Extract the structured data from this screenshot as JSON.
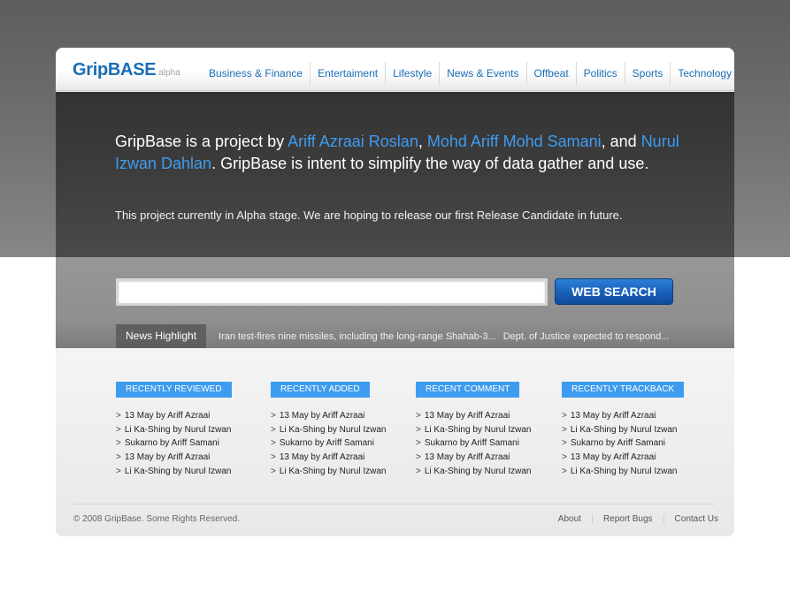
{
  "header": {
    "logo": "GripBASE",
    "logo_tag": "alpha",
    "nav": [
      "Business & Finance",
      "Entertaiment",
      "Lifestyle",
      "News & Events",
      "Offbeat",
      "Politics",
      "Sports",
      "Technology"
    ]
  },
  "hero": {
    "intro_prefix": "GripBase is a project by ",
    "author1": "Ariff Azraai Roslan",
    "sep1": ", ",
    "author2": "Mohd Ariff Mohd Samani",
    "sep2": ", and ",
    "author3": "Nurul Izwan Dahlan",
    "intro_suffix": ". GripBase is intent to simplify the way of data gather and use.",
    "subtext": "This project currently in Alpha stage. We are hoping to release our first Release Candidate in future."
  },
  "search": {
    "value": "",
    "button_label": "WEB SEARCH"
  },
  "news": {
    "label": "News Highlight",
    "items": [
      "Iran test-fires nine missiles, including the long-range Shahab-3...",
      "Dept. of Justice expected to respond..."
    ]
  },
  "lists": [
    {
      "heading": "RECENTLY REVIEWED",
      "items": [
        "13 May by Ariff Azraai",
        "Li Ka-Shing by Nurul Izwan",
        "Sukarno by Ariff Samani",
        "13 May by Ariff Azraai",
        "Li Ka-Shing by Nurul Izwan"
      ]
    },
    {
      "heading": "RECENTLY ADDED",
      "items": [
        "13 May by Ariff Azraai",
        "Li Ka-Shing by Nurul Izwan",
        "Sukarno by Ariff Samani",
        "13 May by Ariff Azraai",
        "Li Ka-Shing by Nurul Izwan"
      ]
    },
    {
      "heading": "RECENT COMMENT",
      "items": [
        "13 May by Ariff Azraai",
        "Li Ka-Shing by Nurul Izwan",
        "Sukarno by Ariff Samani",
        "13 May by Ariff Azraai",
        "Li Ka-Shing by Nurul Izwan"
      ]
    },
    {
      "heading": "RECENTLY TRACKBACK",
      "items": [
        "13 May by Ariff Azraai",
        "Li Ka-Shing by Nurul Izwan",
        "Sukarno by Ariff Samani",
        "13 May by Ariff Azraai",
        "Li Ka-Shing by Nurul Izwan"
      ]
    }
  ],
  "footer": {
    "copyright": "© 2008 GripBase. Some Rights Reserved.",
    "links": [
      "About",
      "Report Bugs",
      "Contact Us"
    ]
  },
  "colors": {
    "brand_blue": "#1a6db5",
    "accent_blue": "#3e9cf0",
    "hero_bg": "#3d3d3d"
  },
  "icons": {
    "list_bullet": "chevron-right-icon"
  }
}
